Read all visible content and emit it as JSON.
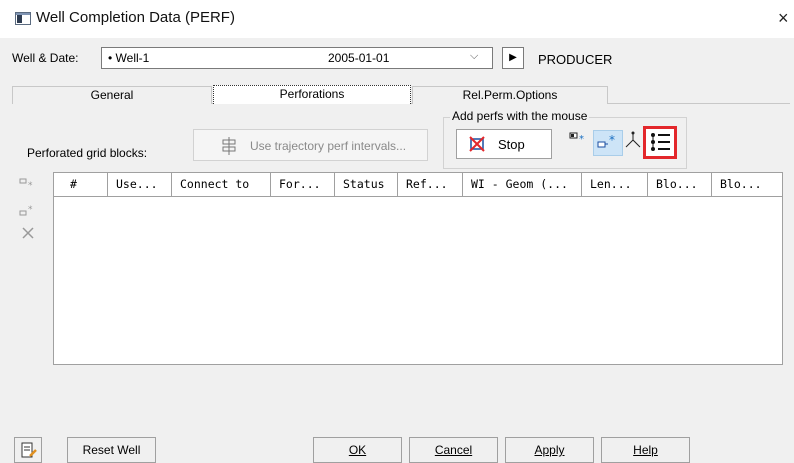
{
  "window": {
    "title": "Well Completion Data (PERF)",
    "close_glyph": "×"
  },
  "well_date": {
    "label": "Well & Date:",
    "well": "• Well-1",
    "date": "2005-01-01",
    "dropdown_glyph": "⌵",
    "play_glyph": "▶",
    "well_type": "PRODUCER"
  },
  "tabs": [
    {
      "label": "General",
      "active": false
    },
    {
      "label": "Perforations",
      "active": true
    },
    {
      "label": "Rel.Perm.Options",
      "active": false
    }
  ],
  "perforations": {
    "grid_blocks_label": "Perforated grid blocks:",
    "trajectory_button": "Use trajectory perf intervals...",
    "mouse_group_title": "Add perfs with the mouse",
    "stop_button": "Stop"
  },
  "table": {
    "columns": [
      "#",
      "Use...",
      "Connect to",
      "For...",
      "Status",
      "Ref...",
      "WI - Geom (...",
      "Len...",
      "Blo...",
      "Blo..."
    ],
    "rows": []
  },
  "buttons": {
    "reset_well": "Reset Well",
    "ok": "OK",
    "cancel": "Cancel",
    "apply": "Apply",
    "help": "Help"
  },
  "colors": {
    "highlight_border": "#e3272b",
    "active_tool_bg": "#cde4f7",
    "window_bg": "#f0f0f0"
  },
  "icons": [
    "app-icon",
    "close-icon",
    "play-icon",
    "trajectory-icon",
    "stop-icon",
    "add-perf-icon",
    "add-perf-active-icon",
    "branch-icon",
    "list-icon",
    "side-add-icon",
    "side-insert-icon",
    "side-delete-icon",
    "notes-icon"
  ]
}
